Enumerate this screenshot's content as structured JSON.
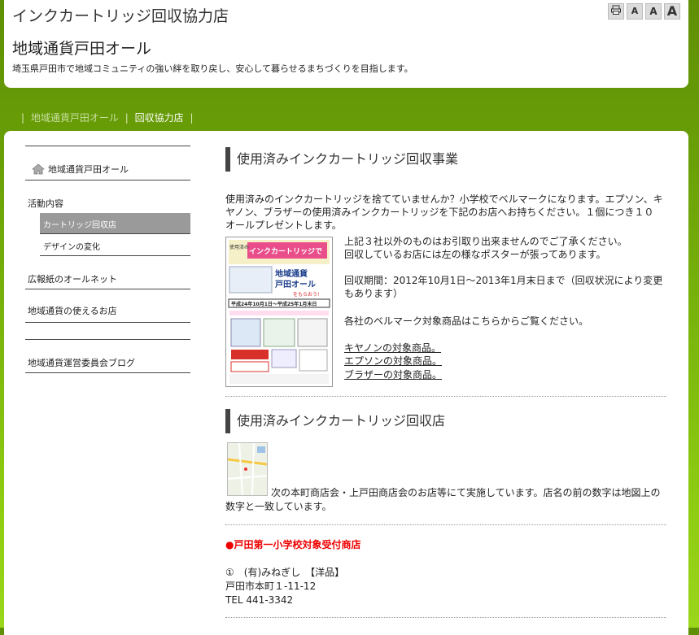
{
  "header": {
    "site_title": "インクカートリッジ回収協力店",
    "org_title": "地域通貨戸田オール",
    "tagline": "埼玉県戸田市で地域コミュニティの強い絆を取り戻し、安心して暮らせるまちづくりを目指します。",
    "font_tools": [
      "A",
      "A",
      "A"
    ]
  },
  "nav": {
    "sep": "|",
    "items": [
      "地域通貨戸田オール",
      "回収協力店"
    ]
  },
  "sidebar": {
    "home": "地域通貨戸田オール",
    "activity": "活動内容",
    "sub_items": [
      "カートリッジ回収店",
      "デザインの変化"
    ],
    "newsletter": "広報紙のオールネット",
    "shops": "地域通貨の使えるお店",
    "blog": "地域通貨運営委員会ブログ"
  },
  "section1": {
    "heading": "使用済みインクカートリッジ回収事業",
    "intro_1": "使用済みのインクカートリッジを捨てていませんか？小学校でベルマークになります。エプソン、キ",
    "intro_2": "ヤノン、ブラザーの使用済みインクカートリッジを下記のお店へお持ちください。１個につき１０",
    "intro_3": "オールプレゼントします。",
    "note_1": "上記３社以外のものはお引取り出来ませんのでご了承ください。",
    "note_2": "回収しているお店には左の様なポスターが張ってあります。",
    "period_1": "回収期間：2012年10月1日〜2013年1月末日まで（回収状況により変更",
    "period_2": "もあります）",
    "bellmark": "各社のベルマーク対象商品はこちらからご覧ください。",
    "links": [
      "キヤノンの対象商品。",
      "エプソンの対象商品。",
      "ブラザーの対象商品。"
    ]
  },
  "poster": {
    "top_left": "使用済み",
    "title": "インクカートリッジで",
    "big_1": "地域通貨",
    "big_2": "戸田オール",
    "big_3": "をもらおう!",
    "period": "平成24年10月1日〜平成25年1月末日"
  },
  "section2": {
    "heading": "使用済みインクカートリッジ回収店",
    "desc_1": "次の本町商店会・上戸田商店会のお店等にて実施しています。店名の前の数字は地図上の",
    "desc_2": "数字と一致しています。",
    "school_heading": "●戸田第一小学校対象受付商店",
    "shop_name": "①　(有)みねぎし　【洋品】",
    "shop_address": "戸田市本町１-11-12",
    "shop_tel": "TEL 441-3342"
  },
  "colors": {
    "accent_red": "#e00000",
    "green": "#6aa007"
  }
}
